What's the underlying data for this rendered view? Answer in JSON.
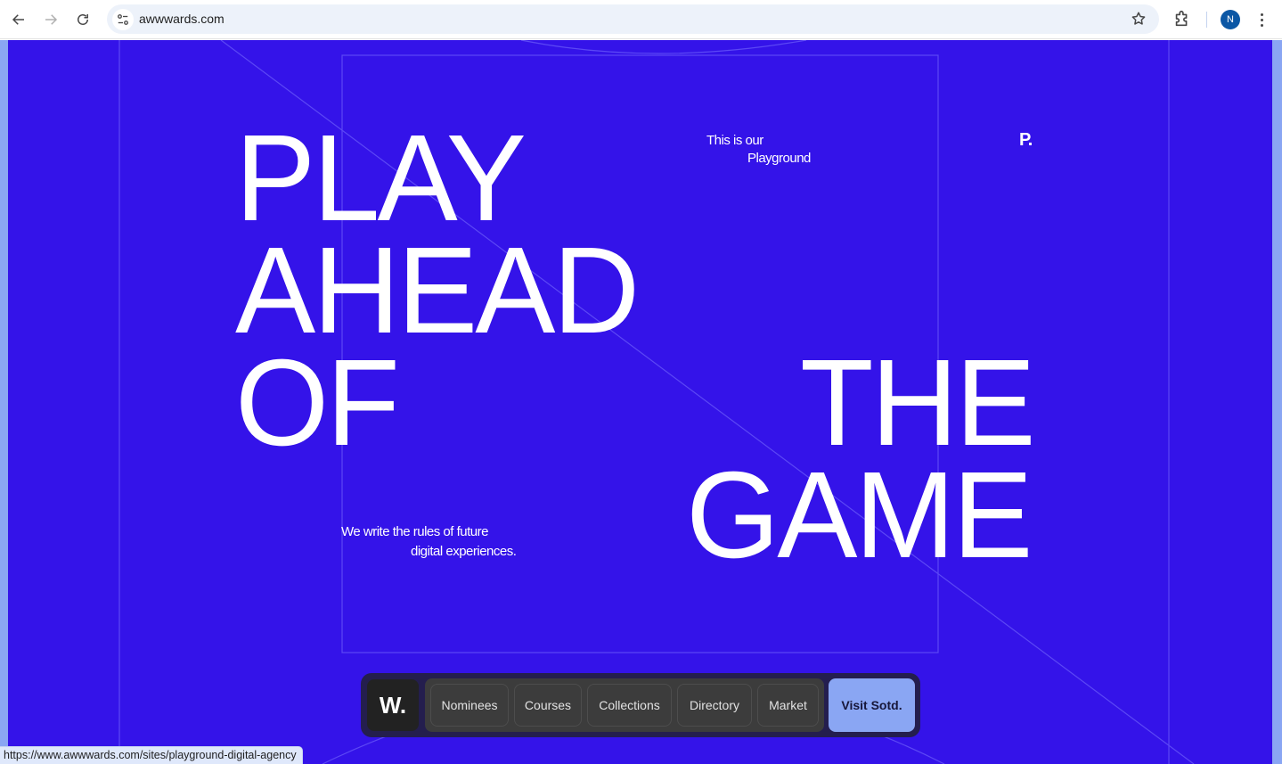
{
  "browser": {
    "url": "awwwards.com",
    "avatar_initial": "N",
    "icons": [
      "back-arrow-icon",
      "forward-arrow-icon",
      "reload-icon",
      "site-settings-icon",
      "bookmark-star-icon",
      "extensions-icon",
      "profile-avatar",
      "kebab-menu-icon"
    ],
    "status_url": "https://www.awwwards.com/sites/playground-digital-agency"
  },
  "hero": {
    "words": {
      "play": "PLAY",
      "ahead": "AHEAD",
      "of": "OF",
      "the": "THE",
      "game": "GAME"
    },
    "intro": {
      "line1": "This is our",
      "line2": "Playground"
    },
    "tagline": {
      "line1": "We write the rules of future",
      "line2": "digital experiences."
    },
    "brand_logo": "P.",
    "colors": {
      "background": "#3413e9",
      "text": "#ffffff",
      "accent": "#8aa6f3"
    }
  },
  "bottom_nav": {
    "logo": "W.",
    "items": [
      {
        "label": "Nominees"
      },
      {
        "label": "Courses"
      },
      {
        "label": "Collections"
      },
      {
        "label": "Directory"
      },
      {
        "label": "Market"
      }
    ],
    "cta": "Visit Sotd."
  }
}
